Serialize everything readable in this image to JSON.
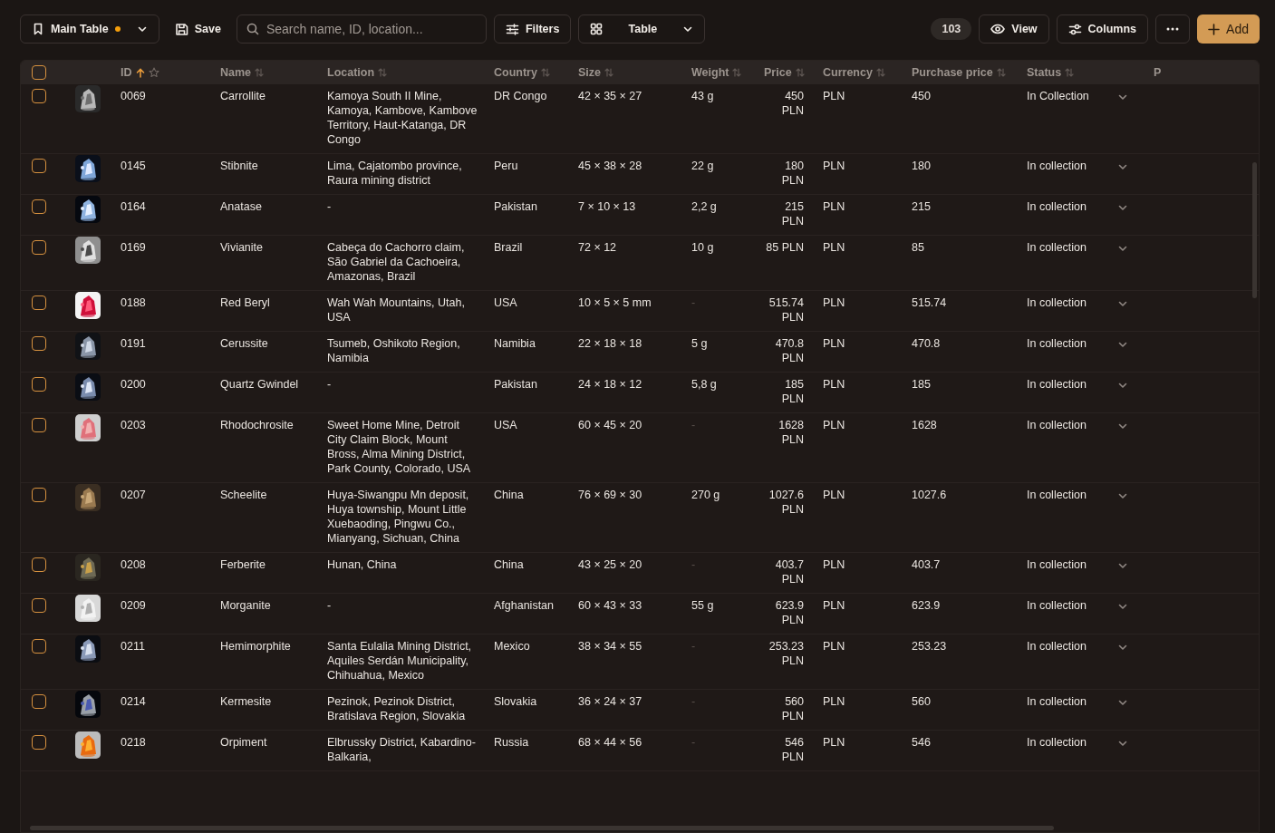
{
  "toolbar": {
    "table_menu": {
      "label": "Main Table",
      "modified": true
    },
    "save": "Save",
    "search": {
      "placeholder": "Search name, ID, location..."
    },
    "filters": "Filters",
    "view_select": "Table",
    "count": "103",
    "view": "View",
    "columns": "Columns",
    "add": "Add"
  },
  "table": {
    "all_checked": false,
    "columns": [
      {
        "label": "ID",
        "sorted": true,
        "starred": false
      },
      {
        "label": "Name",
        "sorted": false
      },
      {
        "label": "Location",
        "sorted": false
      },
      {
        "label": "Country",
        "sorted": false
      },
      {
        "label": "Size",
        "sorted": false
      },
      {
        "label": "Weight",
        "sorted": false
      },
      {
        "label": "Price",
        "sorted": false
      },
      {
        "label": "Currency",
        "sorted": false
      },
      {
        "label": "Purchase price",
        "sorted": false
      },
      {
        "label": "Status",
        "sorted": false
      },
      {
        "label": "P"
      }
    ],
    "rows": [
      {
        "checked": false,
        "id": "0069",
        "name": "Carrollite",
        "location": "Kamoya South II Mine, Kamoya, Kambove, Kambove Territory, Haut-Katanga, DR Congo",
        "country": "DR Congo",
        "size": "42 × 35 × 27",
        "weight": {
          "text": "43 g",
          "muted": false
        },
        "price": "450 PLN",
        "currency": "PLN",
        "purchase_price": "450",
        "status": "In Collection"
      },
      {
        "checked": false,
        "id": "0145",
        "name": "Stibnite",
        "location": "Lima, Cajatombo province, Raura mining district",
        "country": "Peru",
        "size": "45 × 38 × 28",
        "weight": {
          "text": "22 g",
          "muted": false
        },
        "price": "180 PLN",
        "currency": "PLN",
        "purchase_price": "180",
        "status": "In collection"
      },
      {
        "checked": false,
        "id": "0164",
        "name": "Anatase",
        "location": "-",
        "country": "Pakistan",
        "size": "7 × 10 × 13",
        "weight": {
          "text": "2,2 g",
          "muted": false
        },
        "price": "215 PLN",
        "currency": "PLN",
        "purchase_price": "215",
        "status": "In collection"
      },
      {
        "checked": false,
        "id": "0169",
        "name": "Vivianite",
        "location": "Cabeça do Cachorro claim, São Gabriel da Cachoeira, Amazonas, Brazil",
        "country": "Brazil",
        "size": "72 × 12",
        "weight": {
          "text": "10 g",
          "muted": false
        },
        "price": "85 PLN",
        "currency": "PLN",
        "purchase_price": "85",
        "status": "In collection"
      },
      {
        "checked": false,
        "id": "0188",
        "name": "Red Beryl",
        "location": "Wah Wah Mountains, Utah, USA",
        "country": "USA",
        "size": "10 × 5 × 5 mm",
        "weight": {
          "text": "-",
          "muted": true
        },
        "price": "515.74 PLN",
        "currency": "PLN",
        "purchase_price": "515.74",
        "status": "In collection"
      },
      {
        "checked": false,
        "id": "0191",
        "name": "Cerussite",
        "location": "Tsumeb, Oshikoto Region, Namibia",
        "country": "Namibia",
        "size": "22 × 18 × 18",
        "weight": {
          "text": "5 g",
          "muted": false
        },
        "price": "470.8 PLN",
        "currency": "PLN",
        "purchase_price": "470.8",
        "status": "In collection"
      },
      {
        "checked": false,
        "id": "0200",
        "name": "Quartz Gwindel",
        "location": "-",
        "country": "Pakistan",
        "size": "24 × 18 × 12",
        "weight": {
          "text": "5,8 g",
          "muted": false
        },
        "price": "185 PLN",
        "currency": "PLN",
        "purchase_price": "185",
        "status": "In collection"
      },
      {
        "checked": false,
        "id": "0203",
        "name": "Rhodochrosite",
        "location": "Sweet Home Mine, Detroit City Claim Block, Mount Bross, Alma Mining District, Park County, Colorado, USA",
        "country": "USA",
        "size": "60 × 45 × 20",
        "weight": {
          "text": "-",
          "muted": true
        },
        "price": "1628 PLN",
        "currency": "PLN",
        "purchase_price": "1628",
        "status": "In collection"
      },
      {
        "checked": false,
        "id": "0207",
        "name": "Scheelite",
        "location": "Huya-Siwangpu Mn deposit, Huya township, Mount Little Xuebaoding, Pingwu Co., Mianyang, Sichuan, China",
        "country": "China",
        "size": "76 × 69 × 30",
        "weight": {
          "text": "270 g",
          "muted": false
        },
        "price": "1027.6 PLN",
        "currency": "PLN",
        "purchase_price": "1027.6",
        "status": "In collection"
      },
      {
        "checked": false,
        "id": "0208",
        "name": "Ferberite",
        "location": "Hunan, China",
        "country": "China",
        "size": "43 × 25 × 20",
        "weight": {
          "text": "-",
          "muted": true
        },
        "price": "403.7 PLN",
        "currency": "PLN",
        "purchase_price": "403.7",
        "status": "In collection"
      },
      {
        "checked": false,
        "id": "0209",
        "name": "Morganite",
        "location": "-",
        "country": "Afghanistan",
        "size": "60 × 43 × 33",
        "weight": {
          "text": "55 g",
          "muted": false
        },
        "price": "623.9 PLN",
        "currency": "PLN",
        "purchase_price": "623.9",
        "status": "In collection"
      },
      {
        "checked": false,
        "id": "0211",
        "name": "Hemimorphite",
        "location": "Santa Eulalia Mining District, Aquiles Serdán Municipality, Chihuahua, Mexico",
        "country": "Mexico",
        "size": "38 × 34 × 55",
        "weight": {
          "text": "-",
          "muted": true
        },
        "price": "253.23 PLN",
        "currency": "PLN",
        "purchase_price": "253.23",
        "status": "In collection"
      },
      {
        "checked": false,
        "id": "0214",
        "name": "Kermesite",
        "location": "Pezinok, Pezinok District, Bratislava Region, Slovakia",
        "country": "Slovakia",
        "size": "36 × 24 × 37",
        "weight": {
          "text": "-",
          "muted": true
        },
        "price": "560 PLN",
        "currency": "PLN",
        "purchase_price": "560",
        "status": "In collection"
      },
      {
        "checked": false,
        "id": "0218",
        "name": "Orpiment",
        "location": "Elbrussky District, Kabardino-Balkaria,",
        "country": "Russia",
        "size": "68 × 44 × 56",
        "weight": {
          "text": "-",
          "muted": true
        },
        "price": "546 PLN",
        "currency": "PLN",
        "purchase_price": "546",
        "status": "In collection"
      }
    ]
  }
}
